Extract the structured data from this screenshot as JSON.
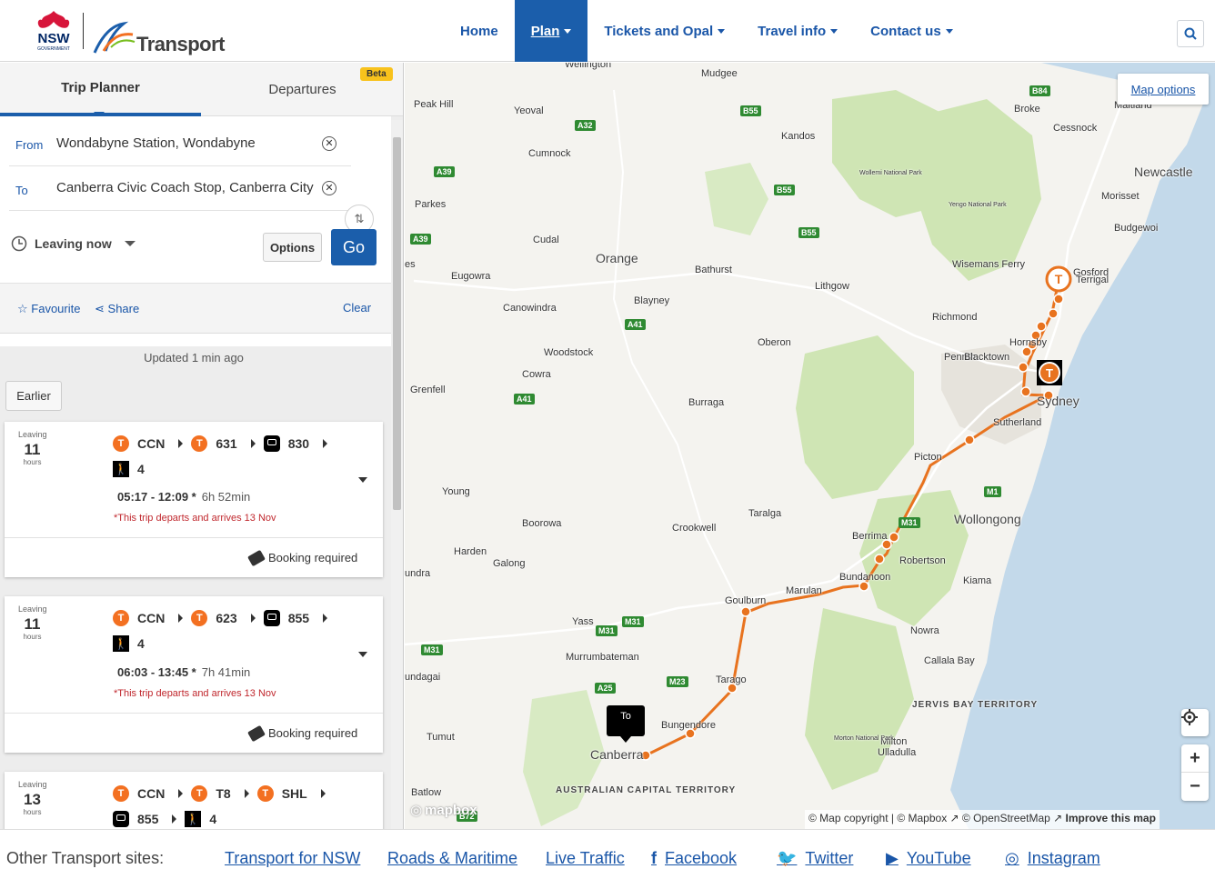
{
  "header": {
    "logo_nsw": "NSW",
    "logo_nsw_sub": "GOVERNMENT",
    "logo_transport": "Transport",
    "nav": [
      {
        "label": "Home"
      },
      {
        "label": "Plan"
      },
      {
        "label": "Tickets and Opal"
      },
      {
        "label": "Travel info"
      },
      {
        "label": "Contact us"
      }
    ],
    "search_icon": "search-icon"
  },
  "tabs": {
    "trip_planner": "Trip Planner",
    "departures": "Departures",
    "beta": "Beta"
  },
  "form": {
    "from_label": "From",
    "from_value": "Wondabyne Station, Wondabyne",
    "to_label": "To",
    "to_value": "Canberra Civic Coach Stop, Canberra City",
    "leaving": "Leaving now",
    "options": "Options",
    "go": "Go",
    "favourite": "Favourite",
    "share": "Share",
    "clear": "Clear"
  },
  "results": {
    "updated": "Updated 1 min ago",
    "earlier": "Earlier",
    "trips": [
      {
        "leaving_label": "Leaving",
        "leaving_num": "11",
        "leaving_unit": "hours",
        "legs": [
          {
            "mode": "train",
            "badge": "T",
            "label": "CCN"
          },
          {
            "mode": "train",
            "badge": "T",
            "label": "631"
          },
          {
            "mode": "bus",
            "badge": "",
            "label": "830"
          },
          {
            "mode": "walk",
            "badge": "",
            "label": "4"
          }
        ],
        "times": "05:17 - 12:09 *",
        "duration": "6h 52min",
        "note": "*This trip departs and arrives 13 Nov",
        "booking": "Booking required"
      },
      {
        "leaving_label": "Leaving",
        "leaving_num": "11",
        "leaving_unit": "hours",
        "legs": [
          {
            "mode": "train",
            "badge": "T",
            "label": "CCN"
          },
          {
            "mode": "train",
            "badge": "T",
            "label": "623"
          },
          {
            "mode": "coach",
            "badge": "",
            "label": "855"
          },
          {
            "mode": "walk",
            "badge": "",
            "label": "4"
          }
        ],
        "times": "06:03 - 13:45 *",
        "duration": "7h 41min",
        "note": "*This trip departs and arrives 13 Nov",
        "booking": "Booking required"
      },
      {
        "leaving_label": "Leaving",
        "leaving_num": "13",
        "leaving_unit": "hours",
        "legs": [
          {
            "mode": "train",
            "badge": "T",
            "label": "CCN"
          },
          {
            "mode": "train",
            "badge": "T",
            "label": "T8"
          },
          {
            "mode": "train",
            "badge": "T",
            "label": "SHL"
          },
          {
            "mode": "coach",
            "badge": "",
            "label": "855"
          },
          {
            "mode": "walk",
            "badge": "",
            "label": "4"
          }
        ]
      }
    ]
  },
  "map": {
    "options": "Map options",
    "to_marker": "To",
    "attribution": "© Map copyright | © Mapbox ↗ © OpenStreetMap ↗",
    "improve": "Improve this map",
    "mapbox": "mapbox",
    "zoom_in": "+",
    "zoom_out": "−",
    "places": [
      {
        "name": "Wellington"
      },
      {
        "name": "Mudgee"
      },
      {
        "name": "Peak Hill"
      },
      {
        "name": "Yeoval"
      },
      {
        "name": "Kandos"
      },
      {
        "name": "Cumnock"
      },
      {
        "name": "Wollemi National Park"
      },
      {
        "name": "Parkes"
      },
      {
        "name": "Cudal"
      },
      {
        "name": "Orange"
      },
      {
        "name": "Bathurst"
      },
      {
        "name": "Lithgow"
      },
      {
        "name": "Eugowra"
      },
      {
        "name": "Blayney"
      },
      {
        "name": "Canowindra"
      },
      {
        "name": "Oberon"
      },
      {
        "name": "Woodstock"
      },
      {
        "name": "Cowra"
      },
      {
        "name": "Grenfell"
      },
      {
        "name": "Burraga"
      },
      {
        "name": "Young"
      },
      {
        "name": "Boorowa"
      },
      {
        "name": "Crookwell"
      },
      {
        "name": "Taralga"
      },
      {
        "name": "Harden"
      },
      {
        "name": "Galong"
      },
      {
        "name": "Yass"
      },
      {
        "name": "Murrumbateman"
      },
      {
        "name": "Goulburn"
      },
      {
        "name": "Marulan"
      },
      {
        "name": "Tarago"
      },
      {
        "name": "Bungendore"
      },
      {
        "name": "Canberra"
      },
      {
        "name": "Tumut"
      },
      {
        "name": "Batlow"
      },
      {
        "name": "Bundanoon"
      },
      {
        "name": "Berrima"
      },
      {
        "name": "Robertson"
      },
      {
        "name": "Picton"
      },
      {
        "name": "Wollongong"
      },
      {
        "name": "Kiama"
      },
      {
        "name": "Nowra"
      },
      {
        "name": "Callala Bay"
      },
      {
        "name": "Milton"
      },
      {
        "name": "Ulladulla"
      },
      {
        "name": "Morton National Park"
      },
      {
        "name": "Sutherland"
      },
      {
        "name": "Sydney"
      },
      {
        "name": "Penrith"
      },
      {
        "name": "Blacktown"
      },
      {
        "name": "Richmond"
      },
      {
        "name": "Hornsby"
      },
      {
        "name": "Wisemans Ferry"
      },
      {
        "name": "Gosford"
      },
      {
        "name": "Terrigal"
      },
      {
        "name": "Budgewoi"
      },
      {
        "name": "Morisset"
      },
      {
        "name": "Newcastle"
      },
      {
        "name": "Cessnock"
      },
      {
        "name": "Maitland"
      },
      {
        "name": "Broke"
      },
      {
        "name": "Yengo National Park"
      },
      {
        "name": "undagai"
      },
      {
        "name": "undra"
      },
      {
        "name": "es"
      }
    ],
    "regions": [
      {
        "name": "AUSTRALIAN CAPITAL TERRITORY"
      },
      {
        "name": "JERVIS BAY TERRITORY"
      }
    ],
    "roads": [
      {
        "name": "B84"
      },
      {
        "name": "B55"
      },
      {
        "name": "A32"
      },
      {
        "name": "A39"
      },
      {
        "name": "B55"
      },
      {
        "name": "B55"
      },
      {
        "name": "A39"
      },
      {
        "name": "A41"
      },
      {
        "name": "A41"
      },
      {
        "name": "M1"
      },
      {
        "name": "M31"
      },
      {
        "name": "M31"
      },
      {
        "name": "M31"
      },
      {
        "name": "M31"
      },
      {
        "name": "A25"
      },
      {
        "name": "M23"
      },
      {
        "name": "B72"
      }
    ]
  },
  "footer": {
    "label": "Other Transport sites:",
    "links": [
      {
        "label": "Transport for NSW"
      },
      {
        "label": "Roads & Maritime"
      },
      {
        "label": "Live Traffic"
      },
      {
        "label": "Facebook",
        "icon": "facebook-icon"
      },
      {
        "label": "Twitter",
        "icon": "twitter-icon"
      },
      {
        "label": "YouTube",
        "icon": "youtube-icon"
      },
      {
        "label": "Instagram",
        "icon": "instagram-icon"
      }
    ]
  },
  "colors": {
    "brand_blue": "#1b5eab",
    "train_orange": "#f37021",
    "route_orange": "#e8731f",
    "alert_red": "#c0272d"
  }
}
